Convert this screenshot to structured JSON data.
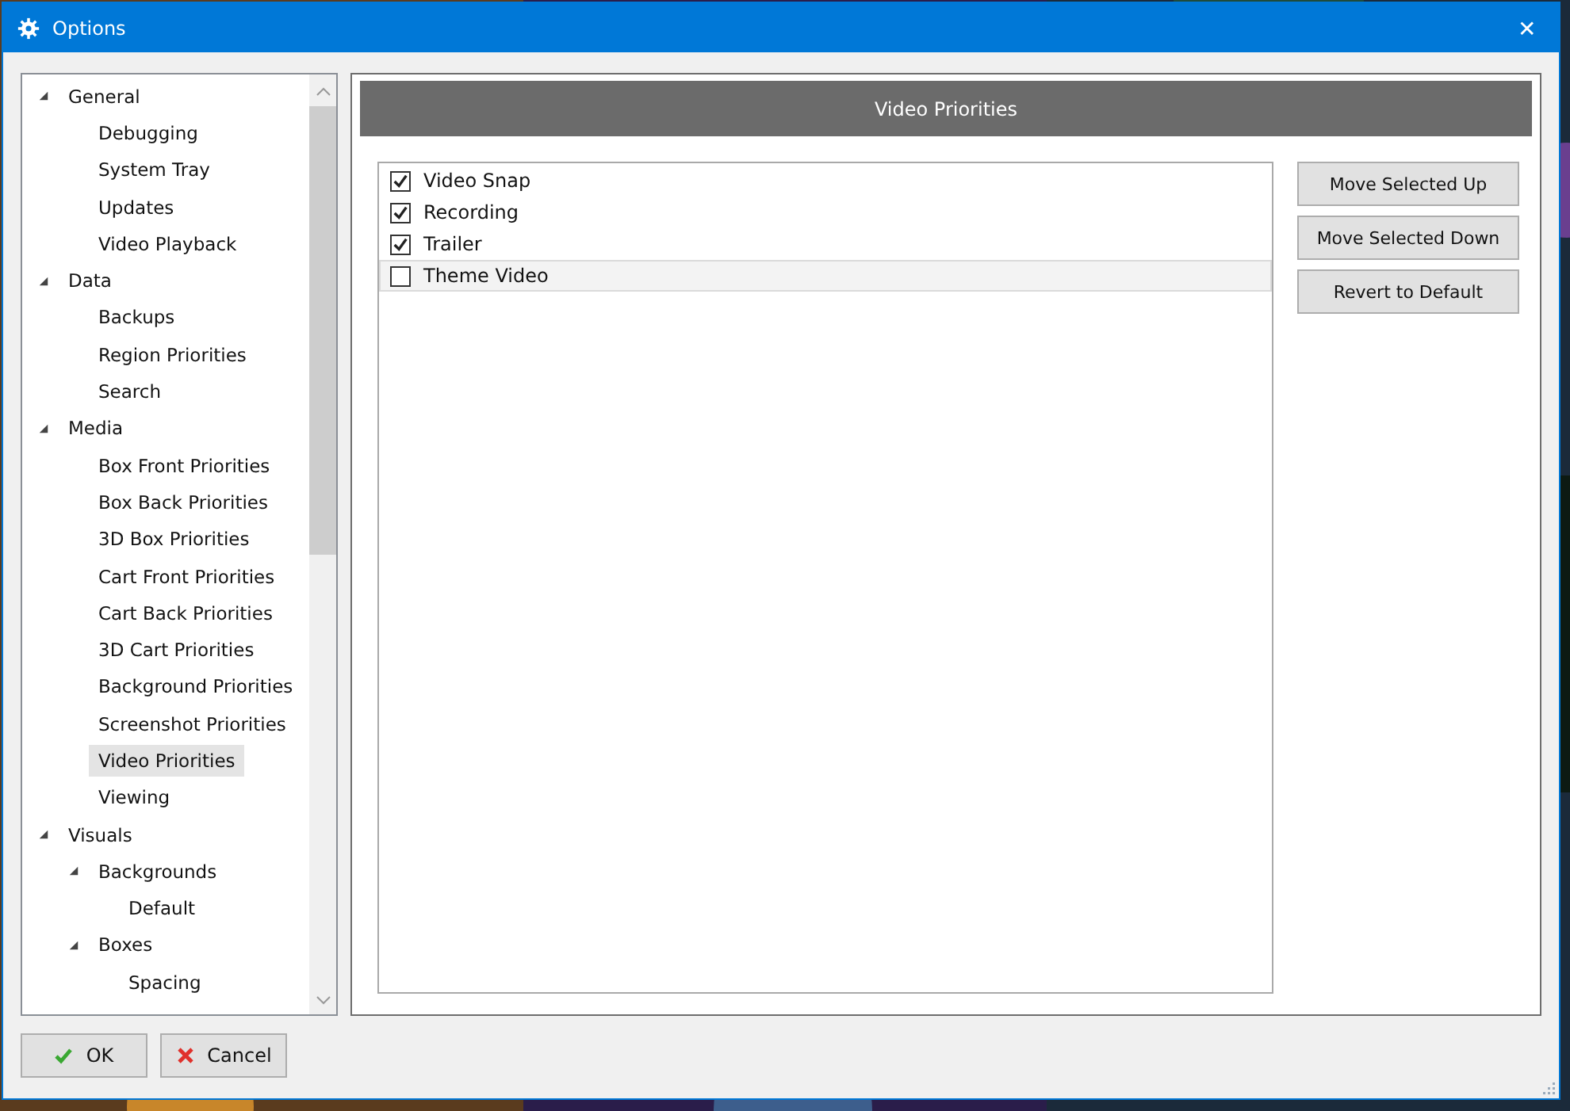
{
  "window": {
    "title": "Options",
    "close": "✕"
  },
  "tree": [
    {
      "label": "General",
      "expanded": true,
      "selected": false,
      "children": [
        {
          "label": "Debugging",
          "selected": false
        },
        {
          "label": "System Tray",
          "selected": false
        },
        {
          "label": "Updates",
          "selected": false
        },
        {
          "label": "Video Playback",
          "selected": false
        }
      ]
    },
    {
      "label": "Data",
      "expanded": true,
      "selected": false,
      "children": [
        {
          "label": "Backups",
          "selected": false
        },
        {
          "label": "Region Priorities",
          "selected": false
        },
        {
          "label": "Search",
          "selected": false
        }
      ]
    },
    {
      "label": "Media",
      "expanded": true,
      "selected": false,
      "children": [
        {
          "label": "Box Front Priorities",
          "selected": false
        },
        {
          "label": "Box Back Priorities",
          "selected": false
        },
        {
          "label": "3D Box Priorities",
          "selected": false
        },
        {
          "label": "Cart Front Priorities",
          "selected": false
        },
        {
          "label": "Cart Back Priorities",
          "selected": false
        },
        {
          "label": "3D Cart Priorities",
          "selected": false
        },
        {
          "label": "Background Priorities",
          "selected": false
        },
        {
          "label": "Screenshot Priorities",
          "selected": false
        },
        {
          "label": "Video Priorities",
          "selected": true
        },
        {
          "label": "Viewing",
          "selected": false
        }
      ]
    },
    {
      "label": "Visuals",
      "expanded": true,
      "selected": false,
      "children": [
        {
          "label": "Backgrounds",
          "expanded": true,
          "selected": false,
          "children": [
            {
              "label": "Default",
              "selected": false
            }
          ]
        },
        {
          "label": "Boxes",
          "expanded": true,
          "selected": false,
          "children": [
            {
              "label": "Spacing",
              "selected": false
            }
          ]
        }
      ]
    }
  ],
  "panel": {
    "title": "Video Priorities"
  },
  "priorities": [
    {
      "label": "Video Snap",
      "checked": true,
      "selected": false
    },
    {
      "label": "Recording",
      "checked": true,
      "selected": false
    },
    {
      "label": "Trailer",
      "checked": true,
      "selected": false
    },
    {
      "label": "Theme Video",
      "checked": false,
      "selected": true
    }
  ],
  "side_buttons": [
    "Move Selected Up",
    "Move Selected Down",
    "Revert to Default"
  ],
  "footer": {
    "ok": "OK",
    "cancel": "Cancel"
  }
}
